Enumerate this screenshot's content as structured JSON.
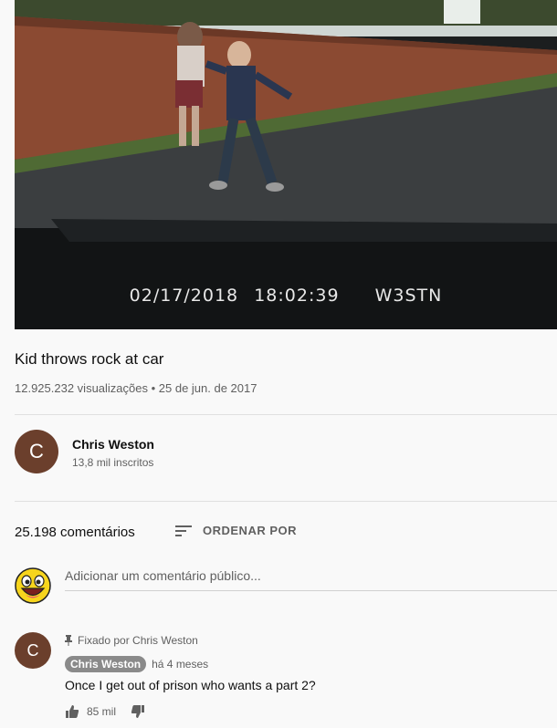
{
  "video": {
    "overlay_date": "02/17/2018",
    "overlay_time": "18:02:39",
    "overlay_tag": "W3STN"
  },
  "title": "Kid throws rock at car",
  "meta": "12.925.232 visualizações • 25 de jun. de 2017",
  "channel": {
    "avatar_letter": "C",
    "name": "Chris Weston",
    "subscribers": "13,8 mil inscritos",
    "avatar_color": "#6b3f2c"
  },
  "comments_header": {
    "count": "25.198 comentários",
    "sort_label": "ORDENAR POR"
  },
  "add_comment": {
    "placeholder": "Adicionar um comentário público..."
  },
  "pinned_comment": {
    "avatar_letter": "C",
    "pinned_label": "Fixado por Chris Weston",
    "author": "Chris Weston",
    "time": "há 4 meses",
    "text": "Once I get out of prison who wants a part 2?",
    "likes": "85 mil"
  }
}
